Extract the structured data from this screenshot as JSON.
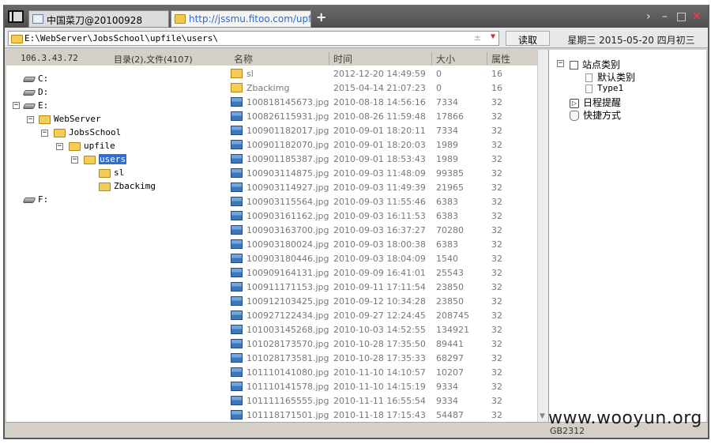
{
  "tabs": [
    {
      "label": "中国菜刀@20100928"
    },
    {
      "label": "http://jssmu.fitoo.com/upfile/..."
    }
  ],
  "new_tab_glyph": "+",
  "window_controls": {
    "chevron": "›",
    "minimize": "–",
    "maximize": "□",
    "close": "✕"
  },
  "address": {
    "path": "E:\\WebServer\\JobsSchool\\upfile\\users\\",
    "plus": "±",
    "dropdown": "▼"
  },
  "read_button": "读取",
  "date_label": "星期三 2015-05-20 四月初三",
  "tree_header": {
    "ip": "106.3.43.72",
    "count": "目录(2),文件(4107)"
  },
  "tree": {
    "c": "C:",
    "d": "D:",
    "e": "E:",
    "webserver": "WebServer",
    "jobsschool": "JobsSchool",
    "upfile": "upfile",
    "users": "users",
    "sl": "sl",
    "zbackimg": "Zbackimg",
    "f": "F:",
    "collapse": "−"
  },
  "columns": {
    "name": "名称",
    "time": "时间",
    "size": "大小",
    "attr": "属性"
  },
  "files": [
    {
      "name": "sl",
      "time": "2012-12-20 14:49:59",
      "size": "0",
      "attr": "16",
      "type": "folder"
    },
    {
      "name": "Zbackimg",
      "time": "2015-04-14 21:07:23",
      "size": "0",
      "attr": "16",
      "type": "folder"
    },
    {
      "name": "100818145673.jpg",
      "time": "2010-08-18 14:56:16",
      "size": "7334",
      "attr": "32",
      "type": "image"
    },
    {
      "name": "100826115931.jpg",
      "time": "2010-08-26 11:59:48",
      "size": "17866",
      "attr": "32",
      "type": "image"
    },
    {
      "name": "100901182017.jpg",
      "time": "2010-09-01 18:20:11",
      "size": "7334",
      "attr": "32",
      "type": "image"
    },
    {
      "name": "100901182070.jpg",
      "time": "2010-09-01 18:20:03",
      "size": "1989",
      "attr": "32",
      "type": "image"
    },
    {
      "name": "100901185387.jpg",
      "time": "2010-09-01 18:53:43",
      "size": "1989",
      "attr": "32",
      "type": "image"
    },
    {
      "name": "100903114875.jpg",
      "time": "2010-09-03 11:48:09",
      "size": "99385",
      "attr": "32",
      "type": "image"
    },
    {
      "name": "100903114927.jpg",
      "time": "2010-09-03 11:49:39",
      "size": "21965",
      "attr": "32",
      "type": "image"
    },
    {
      "name": "100903115564.jpg",
      "time": "2010-09-03 11:55:46",
      "size": "6383",
      "attr": "32",
      "type": "image"
    },
    {
      "name": "100903161162.jpg",
      "time": "2010-09-03 16:11:53",
      "size": "6383",
      "attr": "32",
      "type": "image"
    },
    {
      "name": "100903163700.jpg",
      "time": "2010-09-03 16:37:27",
      "size": "70280",
      "attr": "32",
      "type": "image"
    },
    {
      "name": "100903180024.jpg",
      "time": "2010-09-03 18:00:38",
      "size": "6383",
      "attr": "32",
      "type": "image"
    },
    {
      "name": "100903180446.jpg",
      "time": "2010-09-03 18:04:09",
      "size": "1540",
      "attr": "32",
      "type": "image"
    },
    {
      "name": "100909164131.jpg",
      "time": "2010-09-09 16:41:01",
      "size": "25543",
      "attr": "32",
      "type": "image"
    },
    {
      "name": "100911171153.jpg",
      "time": "2010-09-11 17:11:54",
      "size": "23850",
      "attr": "32",
      "type": "image"
    },
    {
      "name": "100912103425.jpg",
      "time": "2010-09-12 10:34:28",
      "size": "23850",
      "attr": "32",
      "type": "image"
    },
    {
      "name": "100927122434.jpg",
      "time": "2010-09-27 12:24:45",
      "size": "208745",
      "attr": "32",
      "type": "image"
    },
    {
      "name": "101003145268.jpg",
      "time": "2010-10-03 14:52:55",
      "size": "134921",
      "attr": "32",
      "type": "image"
    },
    {
      "name": "101028173570.jpg",
      "time": "2010-10-28 17:35:50",
      "size": "89441",
      "attr": "32",
      "type": "image"
    },
    {
      "name": "101028173581.jpg",
      "time": "2010-10-28 17:35:33",
      "size": "68297",
      "attr": "32",
      "type": "image"
    },
    {
      "name": "101110141080.jpg",
      "time": "2010-11-10 14:10:57",
      "size": "10207",
      "attr": "32",
      "type": "image"
    },
    {
      "name": "101110141578.jpg",
      "time": "2010-11-10 14:15:19",
      "size": "9334",
      "attr": "32",
      "type": "image"
    },
    {
      "name": "101111165555.jpg",
      "time": "2010-11-11 16:55:54",
      "size": "9334",
      "attr": "32",
      "type": "image"
    },
    {
      "name": "101118171501.jpg",
      "time": "2010-11-18 17:15:43",
      "size": "54487",
      "attr": "32",
      "type": "image"
    }
  ],
  "site_tree": {
    "root": "站点类别",
    "default_cat": "默认类别",
    "type1": "Type1",
    "schedule": "日程提醒",
    "shortcuts": "快捷方式",
    "collapse": "−"
  },
  "status": {
    "encoding": "GB2312"
  },
  "watermark": "www.wooyun.org"
}
